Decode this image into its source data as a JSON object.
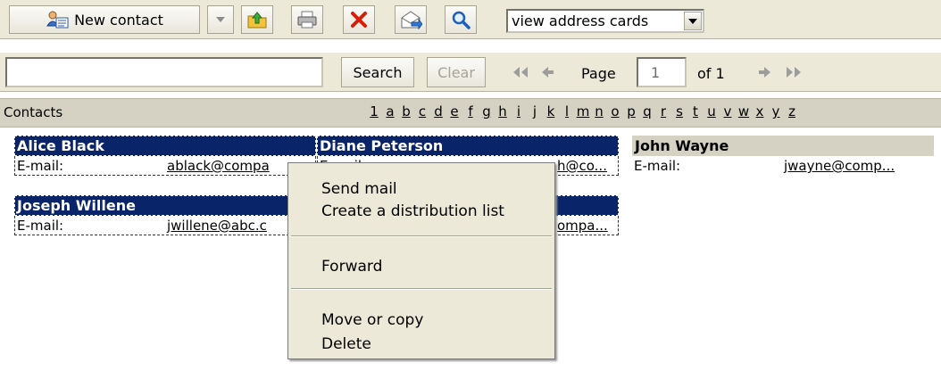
{
  "toolbar": {
    "new_contact_label": "New contact",
    "view_select_value": "view address cards"
  },
  "search": {
    "button_label": "Search",
    "clear_label": "Clear",
    "input_value": ""
  },
  "pager": {
    "page_label": "Page",
    "page_value": "1",
    "of_label": "of 1"
  },
  "contacts_header": {
    "label": "Contacts",
    "letters": [
      "1",
      "a",
      "b",
      "c",
      "d",
      "e",
      "f",
      "g",
      "h",
      "i",
      "j",
      "k",
      "l",
      "m",
      "n",
      "o",
      "p",
      "q",
      "r",
      "s",
      "t",
      "u",
      "v",
      "w",
      "x",
      "y",
      "z"
    ]
  },
  "cards": [
    {
      "name": "Alice Black",
      "field": "E-mail:",
      "value": "ablack@compa"
    },
    {
      "name": "Diane Peterson",
      "field": "E-mail:",
      "value": "h@co..."
    },
    {
      "name": "John Wayne",
      "field": "E-mail:",
      "value": "jwayne@comp..."
    },
    {
      "name": "Joseph Willene",
      "field": "E-mail:",
      "value": "jwillene@abc.c"
    },
    {
      "name": "",
      "field": "",
      "value": "ompa..."
    }
  ],
  "context_menu": {
    "items": [
      "Send mail",
      "Create a distribution list",
      "Forward",
      "Move or copy",
      "Delete"
    ]
  },
  "colors": {
    "selection": "#0a246a",
    "toolbar_bg": "#ece9d8",
    "header_bg": "#d5d2c4"
  },
  "icons": [
    "contact-card-icon",
    "dropdown-arrow-icon",
    "folder-up-icon",
    "print-icon",
    "delete-x-icon",
    "send-mail-icon",
    "search-magnifier-icon",
    "first-page-icon",
    "prev-page-icon",
    "next-page-icon",
    "last-page-icon"
  ]
}
